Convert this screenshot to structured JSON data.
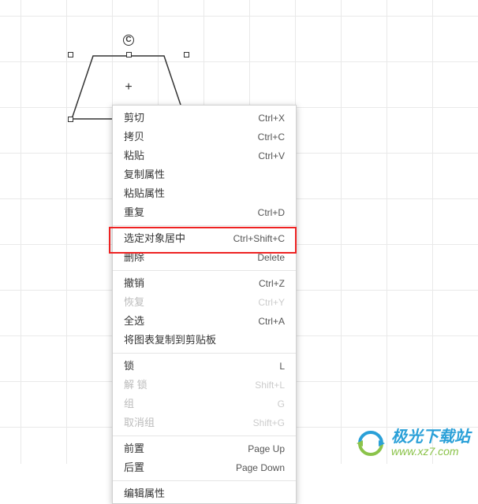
{
  "shape": {
    "type": "trapezoid",
    "center_plus": "+",
    "rotate_glyph": "C"
  },
  "menu": {
    "groups": [
      [
        {
          "label": "剪切",
          "shortcut": "Ctrl+X",
          "enabled": true
        },
        {
          "label": "拷贝",
          "shortcut": "Ctrl+C",
          "enabled": true
        },
        {
          "label": "粘贴",
          "shortcut": "Ctrl+V",
          "enabled": true
        },
        {
          "label": "复制属性",
          "shortcut": "",
          "enabled": true
        },
        {
          "label": "粘贴属性",
          "shortcut": "",
          "enabled": true
        },
        {
          "label": "重复",
          "shortcut": "Ctrl+D",
          "enabled": true
        }
      ],
      [
        {
          "label": "选定对象居中",
          "shortcut": "Ctrl+Shift+C",
          "enabled": true,
          "highlight": true
        },
        {
          "label": "删除",
          "shortcut": "Delete",
          "enabled": true
        }
      ],
      [
        {
          "label": "撤销",
          "shortcut": "Ctrl+Z",
          "enabled": true
        },
        {
          "label": "恢复",
          "shortcut": "Ctrl+Y",
          "enabled": false
        },
        {
          "label": "全选",
          "shortcut": "Ctrl+A",
          "enabled": true
        },
        {
          "label": "将图表复制到剪贴板",
          "shortcut": "",
          "enabled": true
        }
      ],
      [
        {
          "label": "锁",
          "shortcut": "L",
          "enabled": true
        },
        {
          "label": "解 锁",
          "shortcut": "Shift+L",
          "enabled": false
        },
        {
          "label": "组",
          "shortcut": "G",
          "enabled": false
        },
        {
          "label": "取消组",
          "shortcut": "Shift+G",
          "enabled": false
        }
      ],
      [
        {
          "label": "前置",
          "shortcut": "Page Up",
          "enabled": true
        },
        {
          "label": "后置",
          "shortcut": "Page Down",
          "enabled": true
        }
      ],
      [
        {
          "label": "编辑属性",
          "shortcut": "",
          "enabled": true
        }
      ]
    ]
  },
  "watermark": {
    "title": "极光下载站",
    "url": "www.xz7.com"
  }
}
